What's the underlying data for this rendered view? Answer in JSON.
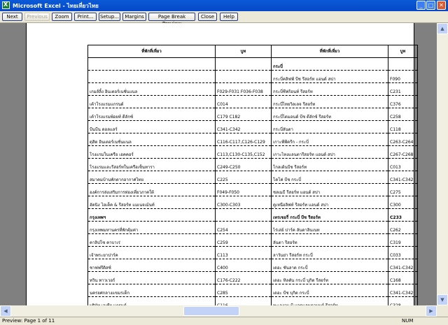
{
  "window": {
    "title": "Microsoft Excel - ไทยเที่ยวไทย"
  },
  "toolbar": {
    "buttons": [
      {
        "label": "Next",
        "disabled": false
      },
      {
        "label": "Previous",
        "disabled": true
      },
      {
        "label": "Zoom",
        "disabled": false
      },
      {
        "label": "Print...",
        "disabled": false
      },
      {
        "label": "Setup...",
        "disabled": false
      },
      {
        "label": "Margins",
        "disabled": false
      },
      {
        "label": "Page Break Preview",
        "disabled": false
      },
      {
        "label": "Close",
        "disabled": false
      },
      {
        "label": "Help",
        "disabled": false
      }
    ]
  },
  "sheet": {
    "headers": [
      "ที่พักที่เที่ยว",
      "บูท",
      "ที่พักที่เที่ยว",
      "บูท"
    ],
    "rows": [
      [
        "",
        "",
        "กระบี่",
        ""
      ],
      [
        "",
        "",
        "กระบี่คลิฟฟ์ บีช รีสอร์ท แอนด์ สปา",
        "F090"
      ],
      [
        "เกมส์ลิ้ง อินเตอร์เนชั่นแนล",
        "F029-F031 F036-F038",
        "กระบี่ซีฟร้อนท์ รีสอร์ท",
        "C231"
      ],
      [
        "เค้าโรงแรมแกรนด์",
        "C014",
        "กระบี่ไทยวิลเลจ รีสอร์ท",
        "C376"
      ],
      [
        "เค้าโรงแรมพ้อยท์ ดีลักซ์",
        "C179 C182",
        "กระบี่ไดมอนด์ บีช ดีลักซ์ รีสอร์ท",
        "C258"
      ],
      [
        "บีนบีน ดอลแลร์",
        "C341-C342",
        "กระบี่ลันตา",
        "C118"
      ],
      [
        "ดุสิต อินเตอร์เนชั่นแนล",
        "C116-C117,C126-C129",
        "เกาะพีพีครีก - กระบี่",
        "C263-C264"
      ],
      [
        "โรงแรมในเครือ เอคคอร์",
        "C113,C130-C135,C152",
        "เกาะไหงแลนตารีสอร์ท แอนด์ สปา",
        "C267-C268"
      ],
      [
        "โรงแรมและรีสอร์ทในเครือเซ็นทารา",
        "C249-C250",
        "โกลเด้นบีช รีสอร์ท",
        "C013"
      ],
      [
        "สมาคมบ้านพักตากอากาศไทย",
        "C225",
        "โคโค่ บีช กระบี่",
        "C341-C342"
      ],
      [
        "องค์การส่งเสริมการท่องเที่ยวภาคใต้",
        "F049-F050",
        "ชลเมธี รีสอร์ท แอนด์ สปา",
        "C275"
      ],
      [
        "ฮัตนิง ไฮเต็ค & รีสอร์ท แมเนจเม้นท์",
        "C300-C303",
        "ดูเหนือลิฟท์ รีสอร์ท แอนด์ สปา",
        "C300"
      ],
      [
        "กรุงเทพฯ",
        "",
        "เทรเชอรี่ กระบี่ บีช รีสอร์ท",
        "C233"
      ],
      [
        "กรุงเทพมหานครที่พักคุ้มค่า",
        "C254",
        "ไร่เล่ย์ ปาร์ค ลันดาลินเนท",
        "C262"
      ],
      [
        "คาลิปโซ คาบาเร่",
        "C259",
        "ลันตา รีสอร์ท",
        "C319"
      ],
      [
        "เจ้าพระยาปาร์ค",
        "C113",
        "ลาวันย่า รีสอร์ท กระบี่",
        "C033"
      ],
      [
        "ชาฟฟรีดิสซ์",
        "C400",
        "เดอะ ซันลาด กระบี่",
        "C341-C342"
      ],
      [
        "ทวิน ทาวเวอร์",
        "C176-C222",
        "เดอะ หิลตัน กระบี่ บุกิต รีสอร์ท",
        "C168"
      ],
      [
        "นครยศกลางแขมรเด็ก",
        "C285",
        "เดอะ บีช บุกิต กระบี่",
        "C341-C342"
      ],
      [
        "บริษัท เอเซีย แกรนด์",
        "C116",
        "ทะเลงาม บี แอดแลนตามนต์ รีสอร์ท",
        "C328"
      ],
      [
        "บริ้นส์ตัน พาร์ค สวีท",
        "C204",
        "พรู แลนเสแลน",
        "C240"
      ]
    ],
    "province_rows": [
      0,
      12
    ]
  },
  "status": {
    "page": "Preview: Page 1 of 11",
    "num": "NUM"
  }
}
